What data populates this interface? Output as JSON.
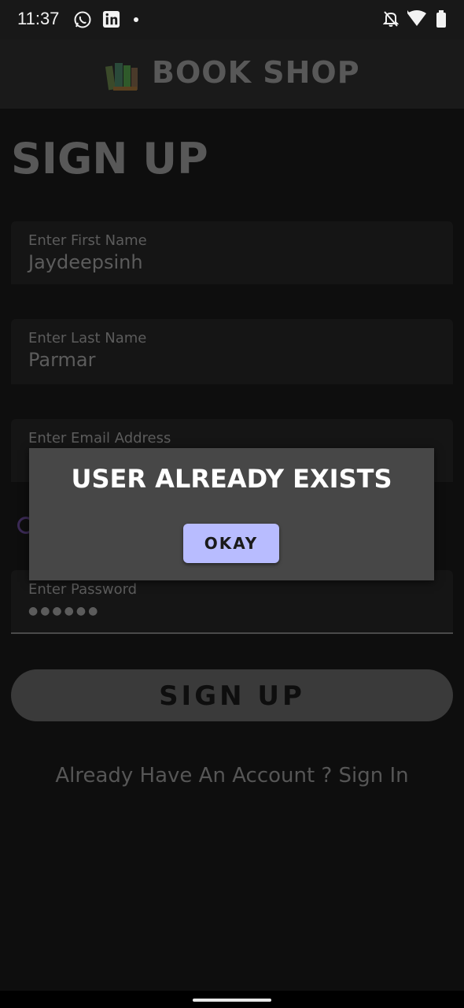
{
  "status_bar": {
    "time": "11:37",
    "icons": [
      "whatsapp-icon",
      "linkedin-icon",
      "notification-dot",
      "mute-bell-icon",
      "wifi-icon",
      "battery-icon"
    ]
  },
  "app_bar": {
    "title": "BOOK SHOP",
    "logo_icon": "books-icon"
  },
  "page": {
    "title": "SIGN UP"
  },
  "form": {
    "first_name": {
      "label": "Enter First Name",
      "value": "Jaydeepsinh"
    },
    "last_name": {
      "label": "Enter Last Name",
      "value": "Parmar"
    },
    "email": {
      "label": "Enter Email Address",
      "value": ""
    },
    "password": {
      "label": "Enter Password",
      "value": "●●●●●●"
    },
    "submit_label": "SIGN UP",
    "signin_link": "Already Have An Account ? Sign In"
  },
  "dialog": {
    "title": "USER ALREADY EXISTS",
    "button_label": "OKAY"
  },
  "colors": {
    "accent_button": "#b8bcff",
    "dialog_bg": "#474747",
    "background": "#0e0e0e"
  }
}
